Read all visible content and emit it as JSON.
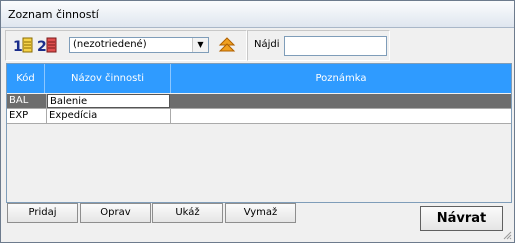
{
  "window": {
    "title": "Zoznam činností"
  },
  "toolbar": {
    "sort1_icon": "sort-by-code-icon",
    "sort2_icon": "sort-by-name-icon",
    "sort_select_value": "(nezotriedené)",
    "sort_direction_icon": "sort-up-icon",
    "find_label": "Nájdi",
    "find_value": ""
  },
  "grid": {
    "columns": [
      "Kód",
      "Názov činnosti",
      "Poznámka"
    ],
    "rows": [
      {
        "code": "BAL",
        "name": "Balenie",
        "note": ""
      },
      {
        "code": "EXP",
        "name": "Expedícia",
        "note": ""
      }
    ]
  },
  "buttons": {
    "add": "Pridaj",
    "edit": "Oprav",
    "show": "Ukáž",
    "delete": "Vymaž",
    "back": "Návrat"
  },
  "colors": {
    "header_bg": "#2f9bff",
    "selected_row": "#6d6d6d"
  }
}
